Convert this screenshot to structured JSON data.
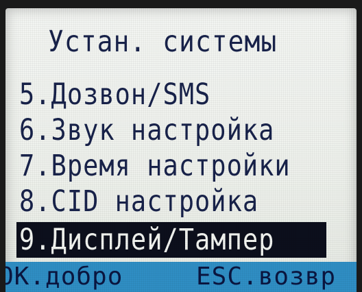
{
  "screen": {
    "title": "Устан. системы"
  },
  "menu": {
    "items": [
      {
        "label": "5.Дозвон/SMS"
      },
      {
        "label": "6.Звук настройка"
      },
      {
        "label": "7.Время настройки"
      },
      {
        "label": "8.CID настройка"
      },
      {
        "label": "9.Дисплей/Тампер",
        "selected": true
      }
    ]
  },
  "softkeys": {
    "ok_label": "OK.добро",
    "esc_label": "ESC.возвр"
  },
  "colors": {
    "lcd_background": "#eef1ec",
    "lcd_text": "#18224a",
    "highlight": "#0c0f1c",
    "softkey_bar": "#2f8ec4"
  }
}
